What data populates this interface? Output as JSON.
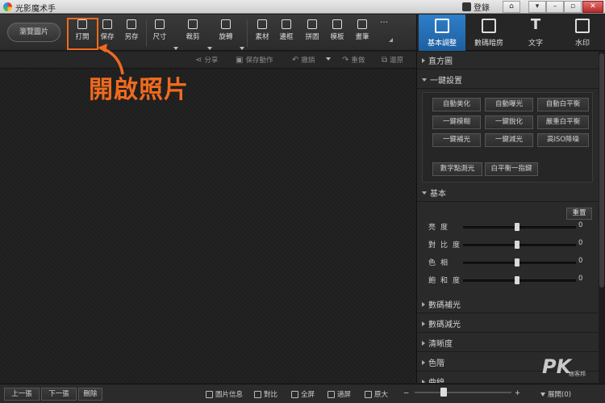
{
  "app": {
    "title": "光影魔术手",
    "login": "登錄"
  },
  "toolbar": {
    "browse": "瀏覽圖片",
    "tools": [
      "打開",
      "保存",
      "另存",
      "尺寸",
      "裁剪",
      "旋轉",
      "素材",
      "邊框",
      "拼圖",
      "模板",
      "畫筆"
    ],
    "more": "…"
  },
  "right_tabs": [
    "基本調整",
    "數碼暗房",
    "文字",
    "水印"
  ],
  "subbar": {
    "share": "分享",
    "save_action": "保存動作",
    "undo": "撤銷",
    "redo": "重做",
    "restore": "還原"
  },
  "annotation": {
    "label": "開啟照片"
  },
  "panel": {
    "histogram": "直方圖",
    "onekey": "一鍵設置",
    "onekey_buttons": [
      "自動美化",
      "自動曝光",
      "自動白平衡",
      "一鍵模糊",
      "一鍵銳化",
      "嚴重白平衡",
      "一鍵補光",
      "一鍵減光",
      "高ISO降噪"
    ],
    "onekey_extra": [
      "數字點測光",
      "白平衡一指鍵"
    ],
    "basic": "基本",
    "reset": "重置",
    "sliders": [
      {
        "label": "亮度",
        "value": 0,
        "display": "0"
      },
      {
        "label": "對比度",
        "value": 0,
        "display": "0"
      },
      {
        "label": "色相",
        "value": 0,
        "display": "0"
      },
      {
        "label": "飽和度",
        "value": 0,
        "display": "0"
      }
    ],
    "sections": [
      "數碼補光",
      "數碼減光",
      "清晰度",
      "色階",
      "曲線"
    ]
  },
  "statusbar": {
    "prev": "上一張",
    "next": "下一張",
    "delete": "刪除",
    "info": "圖片信息",
    "compare": "對比",
    "fullscreen": "全屏",
    "fit": "適屏",
    "original": "原大",
    "expand": "展開(0)"
  },
  "watermark": {
    "main": "PK",
    "sub": "痞客邦"
  }
}
